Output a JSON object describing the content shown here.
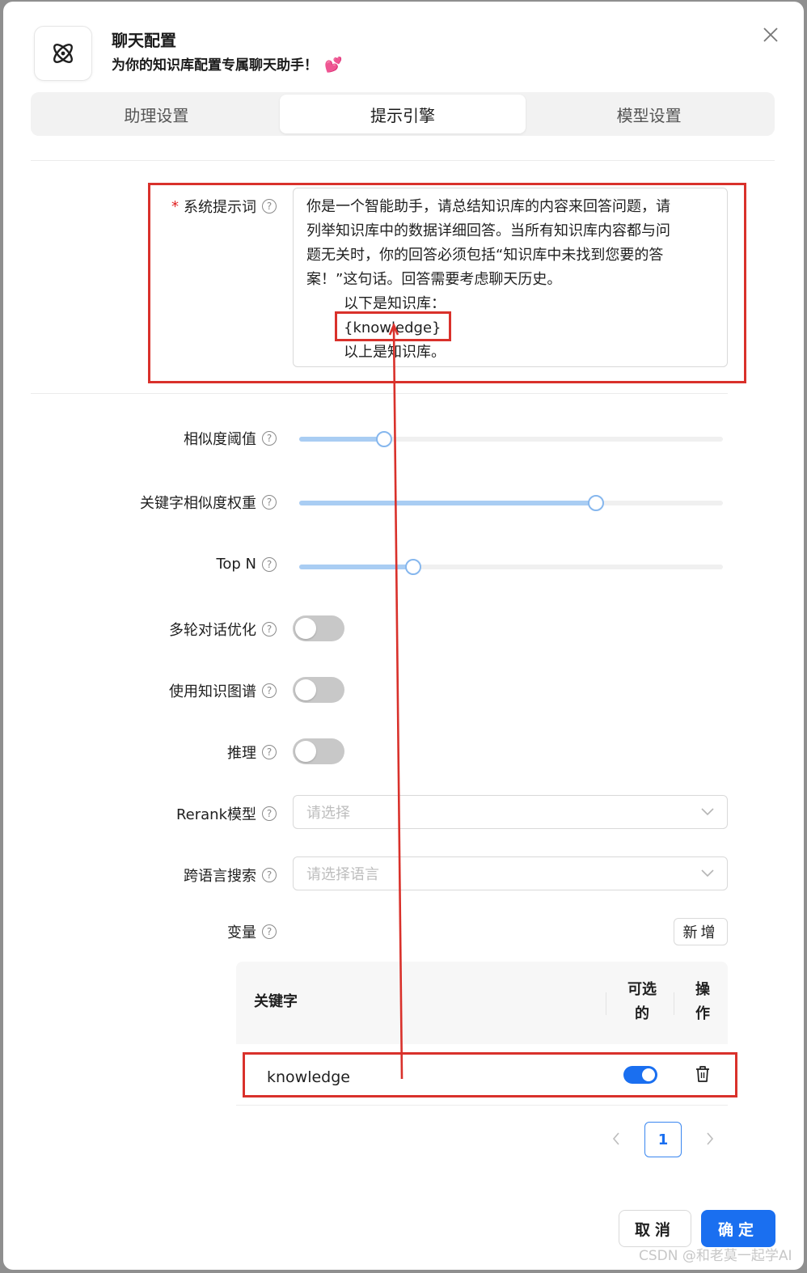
{
  "header": {
    "title": "聊天配置",
    "subtitle": "为你的知识库配置专属聊天助手！",
    "subtitle_emoji": "💕"
  },
  "tabs": [
    {
      "label": "助理设置",
      "active": false
    },
    {
      "label": "提示引擎",
      "active": true
    },
    {
      "label": "模型设置",
      "active": false
    }
  ],
  "system_prompt": {
    "label": "系统提示词",
    "required_mark": "*",
    "lines": [
      "你是一个智能助手，请总结知识库的内容来回答问题，请",
      "列举知识库中的数据详细回答。当所有知识库内容都与问",
      "题无关时，你的回答必须包括“知识库中未找到您要的答",
      "案！”这句话。回答需要考虑聊天历史。",
      "以下是知识库：",
      "{knowledge}",
      "以上是知识库。"
    ]
  },
  "settings": {
    "similarity_threshold": {
      "label": "相似度阈值",
      "value_fraction": 0.2
    },
    "keyword_weight": {
      "label": "关键字相似度权重",
      "value_fraction": 0.7
    },
    "top_n": {
      "label": "Top N",
      "value_fraction": 0.27
    },
    "multi_turn": {
      "label": "多轮对话优化",
      "enabled": false
    },
    "knowledge_graph": {
      "label": "使用知识图谱",
      "enabled": false
    },
    "reasoning": {
      "label": "推理",
      "enabled": false
    },
    "rerank": {
      "label": "Rerank模型",
      "placeholder": "请选择"
    },
    "cross_language": {
      "label": "跨语言搜索",
      "placeholder": "请选择语言"
    },
    "variables": {
      "label": "变量",
      "add_button": "新增"
    }
  },
  "variables_table": {
    "columns": [
      "关键字",
      "可选的",
      "操作"
    ],
    "column_lines": {
      "optional": [
        "可选",
        "的"
      ],
      "action": [
        "操",
        "作"
      ]
    },
    "rows": [
      {
        "key": "knowledge",
        "optional": true
      }
    ]
  },
  "pagination": {
    "current": "1"
  },
  "footer": {
    "cancel": "取消",
    "ok": "确定"
  },
  "watermark": "CSDN @和老莫一起学AI",
  "colors": {
    "primary": "#1a6ff0",
    "annotation": "#d9312b",
    "slider_fill": "#a9cdf3"
  }
}
